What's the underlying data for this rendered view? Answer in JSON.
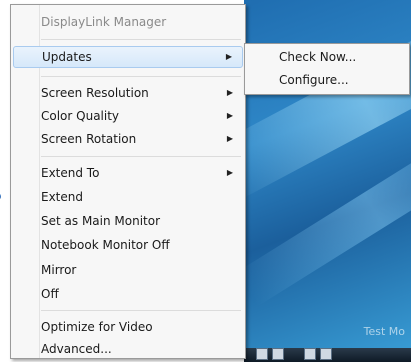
{
  "menu": {
    "header": "DisplayLink Manager",
    "updates": "Updates",
    "screen_resolution": "Screen Resolution",
    "color_quality": "Color Quality",
    "screen_rotation": "Screen Rotation",
    "extend_to": "Extend To",
    "extend": "Extend",
    "set_main_monitor": "Set as Main Monitor",
    "notebook_monitor_off": "Notebook Monitor Off",
    "mirror": "Mirror",
    "off": "Off",
    "optimize_video": "Optimize for Video",
    "advanced": "Advanced...",
    "arrow_glyph": "▶"
  },
  "submenu": {
    "check_now": "Check Now...",
    "configure": "Configure..."
  },
  "desktop": {
    "label": "Test Mo"
  },
  "colors": {
    "selected_bg": "#d6e8fa",
    "selected_border": "#a9cbef",
    "header_text": "#8a8a8a"
  },
  "icons": [
    "submenu-arrow-icon",
    "radio-selected-icon"
  ]
}
